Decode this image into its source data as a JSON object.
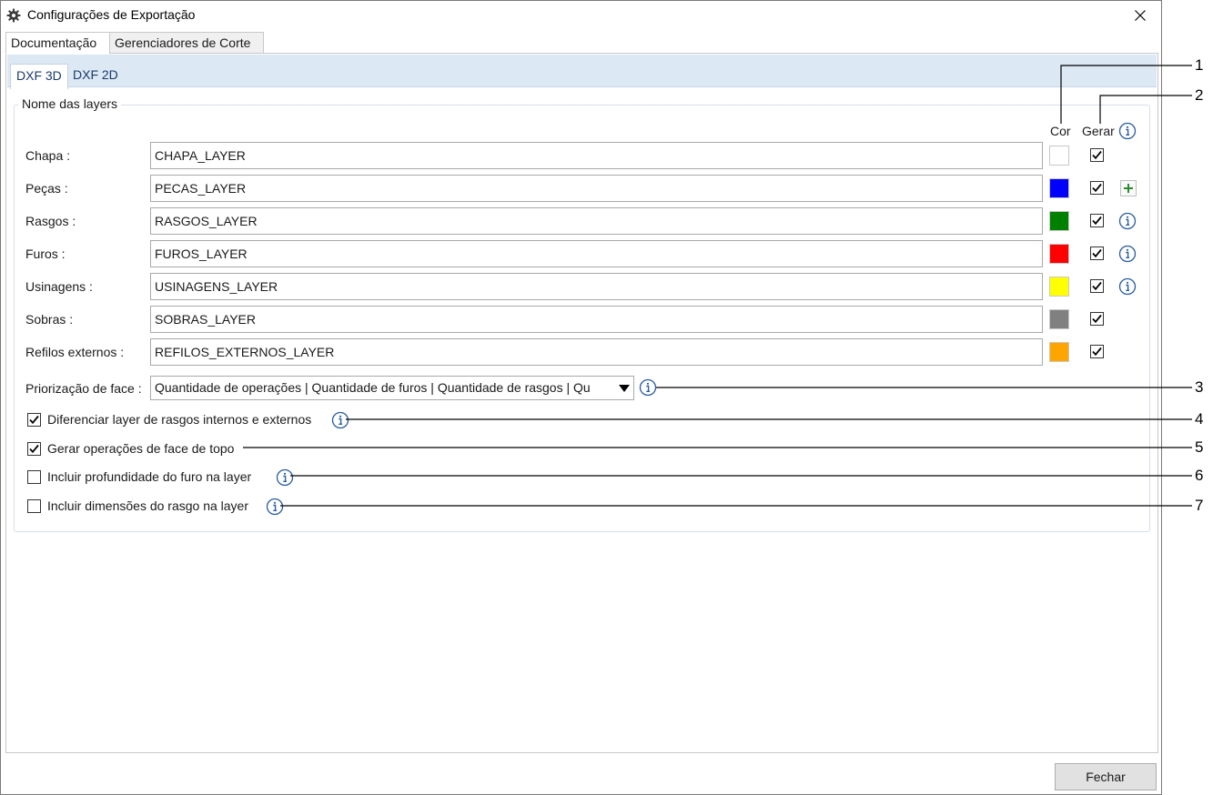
{
  "window": {
    "title": "Configurações de Exportação"
  },
  "main_tabs": [
    "Documentação",
    "Gerenciadores de Corte"
  ],
  "sub_tabs": [
    "DXF 3D",
    "DXF 2D"
  ],
  "group": {
    "title": "Nome das layers",
    "col_color": "Cor",
    "col_generate": "Gerar"
  },
  "layers": [
    {
      "label": "Chapa :",
      "value": "CHAPA_LAYER",
      "color": "#ffffff",
      "generate": true,
      "extra": "none"
    },
    {
      "label": "Peças :",
      "value": "PECAS_LAYER",
      "color": "#0000ff",
      "generate": true,
      "extra": "plus-icon"
    },
    {
      "label": "Rasgos :",
      "value": "RASGOS_LAYER",
      "color": "#008000",
      "generate": true,
      "extra": "info-icon"
    },
    {
      "label": "Furos :",
      "value": "FUROS_LAYER",
      "color": "#ff0000",
      "generate": true,
      "extra": "info-icon"
    },
    {
      "label": "Usinagens :",
      "value": "USINAGENS_LAYER",
      "color": "#ffff00",
      "generate": true,
      "extra": "info-icon"
    },
    {
      "label": "Sobras :",
      "value": "SOBRAS_LAYER",
      "color": "#808080",
      "generate": true,
      "extra": "none"
    },
    {
      "label": "Refilos externos :",
      "value": "REFILOS_EXTERNOS_LAYER",
      "color": "#ffa500",
      "generate": true,
      "extra": "none"
    }
  ],
  "face_priority": {
    "label": "Priorização de face :",
    "value": "Quantidade de operações | Quantidade de furos | Quantidade de rasgos | Qu"
  },
  "options": [
    {
      "label": "Diferenciar layer de rasgos internos e externos",
      "checked": true
    },
    {
      "label": "Gerar operações de face de topo",
      "checked": true
    },
    {
      "label": "Incluir profundidade do furo na layer",
      "checked": false
    },
    {
      "label": "Incluir dimensões do rasgo na layer",
      "checked": false
    }
  ],
  "callouts": [
    "1",
    "2",
    "3",
    "4",
    "5",
    "6",
    "7"
  ],
  "footer": {
    "close_label": "Fechar"
  }
}
